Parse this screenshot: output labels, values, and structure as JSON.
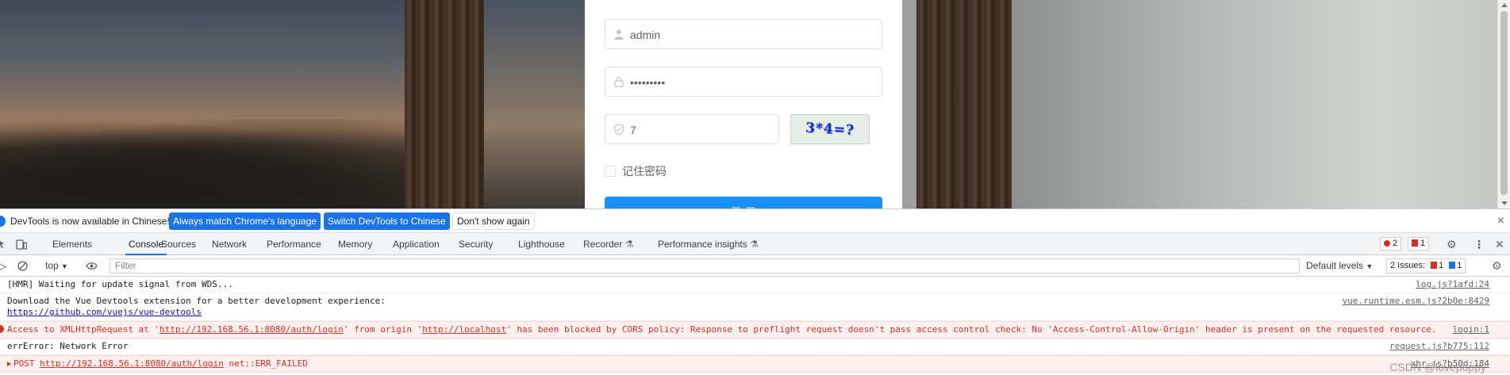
{
  "login": {
    "username_value": "admin",
    "password_value": "•••••••••",
    "captcha_value": "7",
    "captcha_text": "3*4=?",
    "remember_label": "记住密码",
    "login_button": "登 录"
  },
  "infobar": {
    "message": "DevTools is now available in Chinese!",
    "btn_match": "Always match Chrome's language",
    "btn_switch": "Switch DevTools to Chinese",
    "btn_dismiss": "Don't show again",
    "close": "×"
  },
  "tabs": {
    "elements": "Elements",
    "console": "Console",
    "sources": "Sources",
    "network": "Network",
    "performance": "Performance",
    "memory": "Memory",
    "application": "Application",
    "security": "Security",
    "lighthouse": "Lighthouse",
    "recorder": "Recorder",
    "perf_insights": "Performance insights",
    "error_count": "2",
    "issue_count": "1"
  },
  "console_toolbar": {
    "context": "top",
    "filter_placeholder": "Filter",
    "levels": "Default levels",
    "issues_label": "2 Issues:",
    "issues_red": "1",
    "issues_blue": "1"
  },
  "log": [
    {
      "text": "[HMR] Waiting for update signal from WDS...",
      "source": "log.js?1afd:24"
    },
    {
      "text": "Download the Vue Devtools extension for a better development experience:",
      "link": "https://github.com/vuejs/vue-devtools",
      "source": "vue.runtime.esm.js?2b0e:8429"
    },
    {
      "pre": "Access to XMLHttpRequest at '",
      "url1": "http://192.168.56.1:8080/auth/login",
      "mid": "' from origin '",
      "url2": "http://localhost",
      "post": "' has been blocked by CORS policy: Response to preflight request doesn't pass access control check: No 'Access-Control-Allow-Origin' header is present on the requested resource.",
      "source": "login:1"
    },
    {
      "text": "errError: Network Error",
      "source": "request.js?b775:112"
    },
    {
      "method": "POST",
      "url": "http://192.168.56.1:8080/auth/login",
      "status": "net::ERR_FAILED",
      "source": "xhr.js?b50d:184"
    }
  ],
  "watermark": "CSDN @lovepuppy",
  "colors": {
    "accent": "#1a73e8",
    "error": "#d93025",
    "login_button": "#1890ff"
  }
}
